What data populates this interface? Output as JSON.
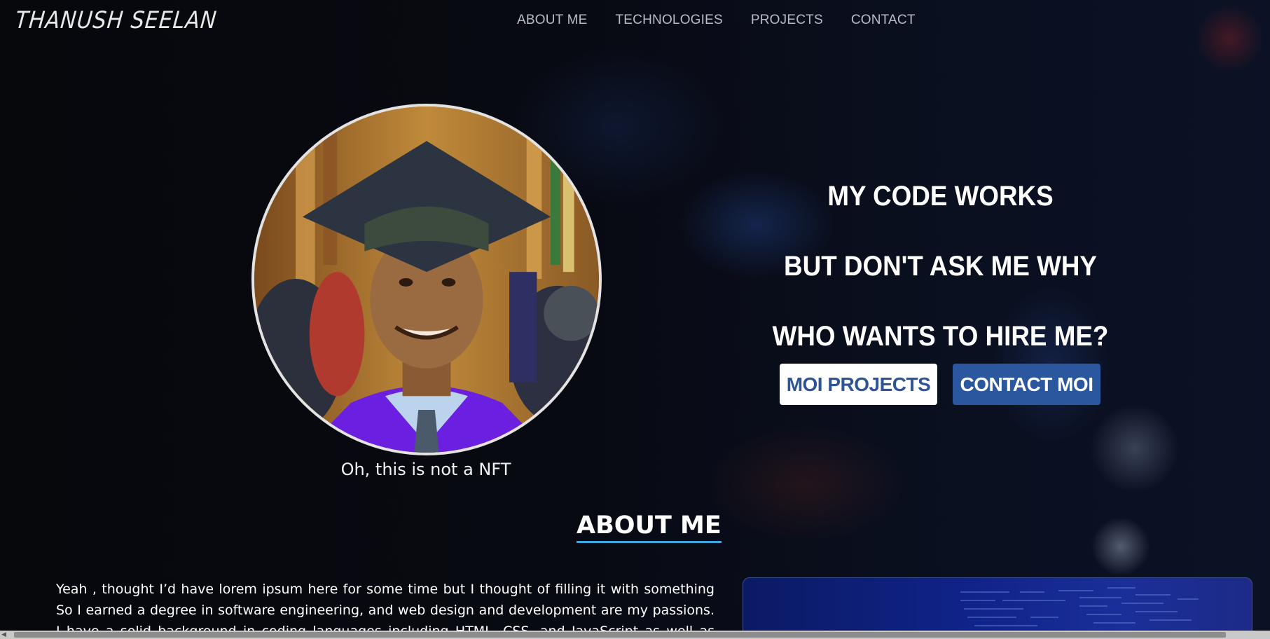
{
  "header": {
    "logo": "THANUSH SEELAN",
    "nav": [
      "ABOUT ME",
      "TECHNOLOGIES",
      "PROJECTS",
      "CONTACT"
    ]
  },
  "profile": {
    "caption": "Oh, this is not a NFT"
  },
  "hero": {
    "lines": [
      "MY CODE WORKS",
      "BUT DON'T ASK ME WHY",
      "WHO WANTS TO HIRE ME?"
    ],
    "buttons": {
      "projects": "MOI PROJECTS",
      "contact": "CONTACT MOI"
    }
  },
  "about": {
    "title": "ABOUT ME",
    "text": "Yeah , thought I’d have lorem ipsum here for some time but I thought of filling it with something So I earned a degree in software engineering, and web design and development are my passions. I have a solid background in coding languages including HTML, CSS, and JavaScript as well as practical knowledge of"
  },
  "colors": {
    "accent_blue": "#2a579e",
    "underline": "#3aa8e0",
    "background": "#07080c"
  },
  "icons": {
    "scroll_left": "scroll-left-arrow-icon"
  }
}
